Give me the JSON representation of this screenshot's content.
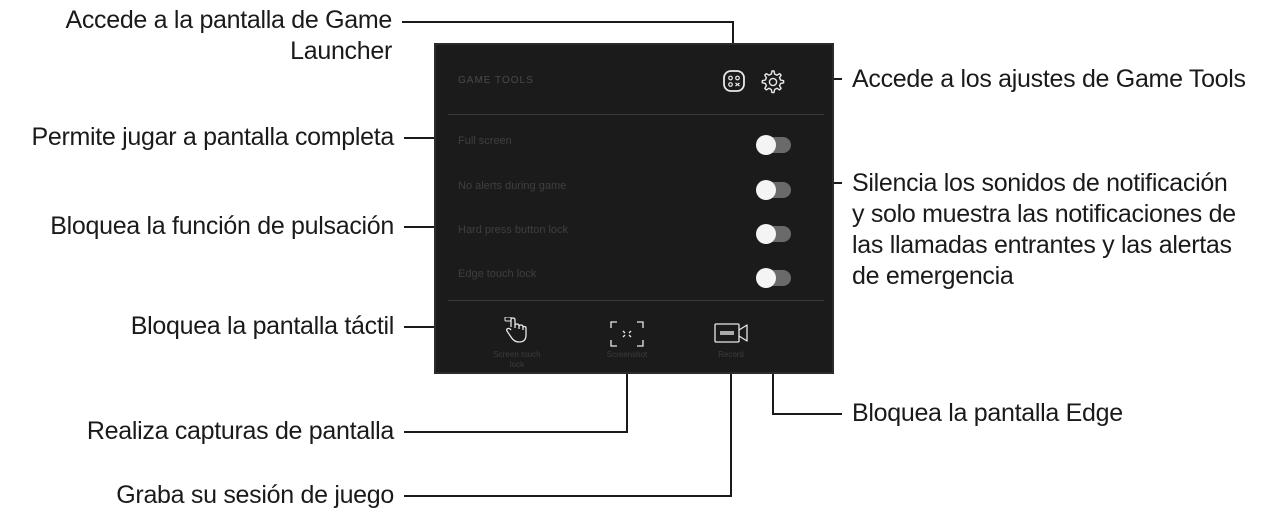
{
  "callouts": {
    "game_launcher_line1": "Accede a la pantalla de Game",
    "game_launcher_line2": "Launcher",
    "settings": "Accede a los ajustes de Game Tools",
    "full_screen": "Permite jugar a pantalla completa",
    "no_alerts_line1": "Silencia los sonidos de notificación",
    "no_alerts_line2": "y solo muestra las notificaciones de",
    "no_alerts_line3": "las llamadas entrantes y las alertas",
    "no_alerts_line4": "de emergencia",
    "hard_press": "Bloquea la función de pulsación",
    "touch_lock": "Bloquea la pantalla táctil",
    "edge_lock": "Bloquea la pantalla Edge",
    "screenshot": "Realiza capturas de pantalla",
    "record": "Graba su sesión de juego"
  },
  "panel": {
    "title": "GAME TOOLS",
    "toggles": [
      {
        "label": "Full screen",
        "on": false
      },
      {
        "label": "No alerts during game",
        "on": false
      },
      {
        "label": "Hard press button lock",
        "on": false
      },
      {
        "label": "Edge touch lock",
        "on": false
      }
    ],
    "bottom_buttons": [
      {
        "label_line1": "Screen touch",
        "label_line2": "lock",
        "icon": "touch-lock-icon"
      },
      {
        "label_line1": "Screenshot",
        "label_line2": "",
        "icon": "screenshot-icon"
      },
      {
        "label_line1": "Record",
        "label_line2": "",
        "icon": "record-icon"
      }
    ],
    "header_icons": [
      "game-launcher-icon",
      "gear-icon"
    ]
  },
  "colors": {
    "panel_bg": "#1c1b1b",
    "leader_line": "#1a1a1a",
    "toggle_track": "#6a6a6a",
    "toggle_knob": "#f4f4f4"
  }
}
